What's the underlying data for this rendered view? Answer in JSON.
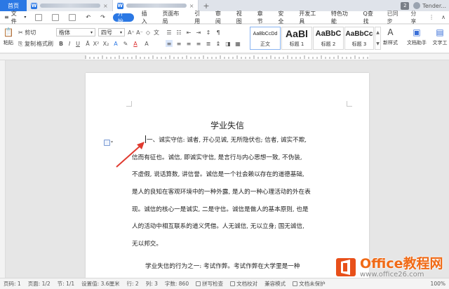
{
  "titlebar": {
    "home_tab": "首页",
    "window_count": "2",
    "user_name": "Tender...",
    "plus": "+"
  },
  "menubar": {
    "file": "文件",
    "items": [
      "开始",
      "插入",
      "页面布局",
      "引用",
      "审阅",
      "视图",
      "章节",
      "安全",
      "开发工具",
      "特色功能"
    ],
    "search": "Q查找",
    "sync": "已同步",
    "share": "分享"
  },
  "ribbon": {
    "cut": "剪切",
    "paste": "粘贴",
    "copy": "复制",
    "format_painter": "格式刷",
    "font_name": "楷体",
    "font_size": "四号",
    "styles": [
      {
        "sample": "AaBbCcDd",
        "label": "正文"
      },
      {
        "sample": "AaBl",
        "label": "标题 1"
      },
      {
        "sample": "AaBbC",
        "label": "标题 2"
      },
      {
        "sample": "AaBbCc",
        "label": "标题 3"
      }
    ],
    "new_style": "新样式",
    "doc_assistant": "文档助手",
    "text_tools": "文字工"
  },
  "document": {
    "title": "学业失信",
    "paragraph1": [
      "一、诚实守信: 诚者, 开心见诚, 无所隐伏也; 信者, 诚实不欺,",
      "信而有征也。诚信, 即诚实守信, 是言行与内心思想一致, 不伪装,",
      "不虚假, 说话算数, 讲信誉。诚信是一个社会赖以存在的道德基础,",
      "是人的良知在客观环境中的一种外露, 是人的一种心理活动的外在表",
      "现。诚信的核心一是诚实, 二是守信。诚信是做人的基本原则, 也是",
      "人的活动中相互联系的道义凭借。人无诚信, 无以立身; 国无诚信,",
      "无以邦交。"
    ],
    "paragraph2_start": "学业失信的行为之一: 考试作弊。考试作弊在大学里是一种"
  },
  "statusbar": {
    "page_num": "页码: 1",
    "page": "页面: 1/2",
    "section": "节: 1/1",
    "setting": "设置值: 3.6厘米",
    "row": "行: 2",
    "col": "列: 3",
    "word_count": "字数: 860",
    "spell_check": "拼写检查",
    "doc_proof": "文档校对",
    "compat": "兼容模式",
    "protect": "文档未保护",
    "zoom": "100%"
  },
  "watermark": {
    "brand": "Office教程网",
    "url": "www.office26.com"
  },
  "colors": {
    "accent": "#2b78e4",
    "watermark": "#f06a16"
  }
}
